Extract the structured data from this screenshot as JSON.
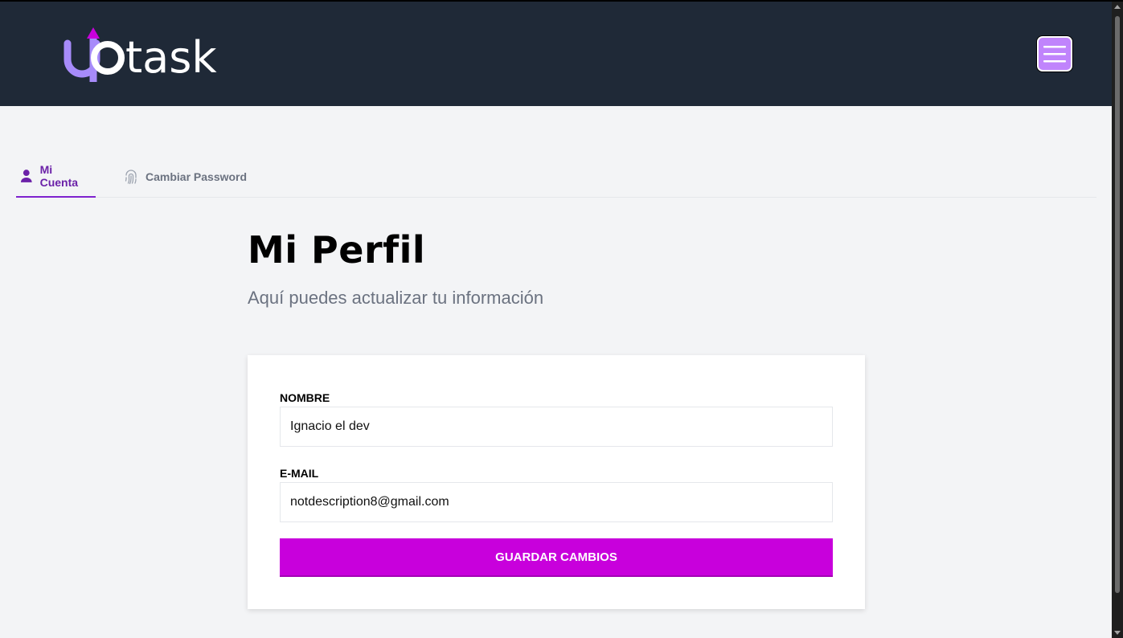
{
  "header": {
    "logo_text": "uptask",
    "menu_icon": "hamburger-menu-icon"
  },
  "tabs": [
    {
      "label": "Mi Cuenta",
      "icon": "user-icon",
      "active": true
    },
    {
      "label": "Cambiar Password",
      "icon": "fingerprint-icon",
      "active": false
    }
  ],
  "page": {
    "title": "Mi Perfil",
    "subtitle": "Aquí puedes actualizar tu información"
  },
  "form": {
    "name_label": "Nombre",
    "name_value": "Ignacio el dev",
    "email_label": "E-mail",
    "email_value": "notdescription8@gmail.com",
    "submit_label": "Guardar Cambios"
  },
  "colors": {
    "header_bg": "#1f2937",
    "accent": "#c800dc",
    "tab_active": "#6b21a8",
    "menu_button": "#c084fc"
  }
}
